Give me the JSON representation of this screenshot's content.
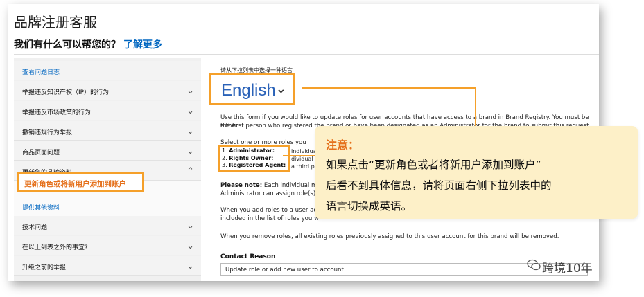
{
  "header": {
    "title": "品牌注册客服",
    "question": "我们有什么可以帮您的？",
    "learn_more": "了解更多"
  },
  "sidebar": {
    "items": [
      {
        "label": "查看问题日志",
        "chevron": ""
      },
      {
        "label": "举报违反知识产权（IP）的行为",
        "chevron": "⌄"
      },
      {
        "label": "举报违反市场政策的行为",
        "chevron": "⌄"
      },
      {
        "label": "撤销违规行为举报",
        "chevron": "⌄"
      },
      {
        "label": "商品页面问题",
        "chevron": "⌄"
      },
      {
        "label": "更新您的品牌资料",
        "chevron": "⌃"
      },
      {
        "label": "提供其他资料",
        "chevron": ""
      },
      {
        "label": "技术问题",
        "chevron": "⌄"
      },
      {
        "label": "在以上列表之外的事宜?",
        "chevron": "⌄"
      },
      {
        "label": "升级之前的举报",
        "chevron": "⌄"
      }
    ],
    "highlighted": "更新角色或将新用户添加到账户"
  },
  "main": {
    "select_prompt": "请从下拉列表中选择一种语言",
    "language": "English",
    "intro_line1": "Use this form if you would like to update roles for user accounts that have access to a brand in Brand Registry. You must be either",
    "intro_line2": "the first person who registered the brand or have been designated as an Administrator for the brand to submit this request.",
    "select_roles_fragment": "Select one or more roles you wou",
    "roles": [
      {
        "num": "1.",
        "name": "Administrator:",
        "side": "individual w"
      },
      {
        "num": "2.",
        "name": "Rights Owner:",
        "side": "dividual w"
      },
      {
        "num": "3.",
        "name": "Registered Agent:",
        "side": "a third part"
      }
    ],
    "note_bold": "Please note:",
    "note_fragment": " Each individual mus",
    "note_line2": "Administrator can assign role(s) f",
    "add_line1": "When you add roles to a user acc",
    "add_line2": "included in the list of roles you w",
    "remove_line": "When you remove roles, all existing roles previously assigned to this user account for this brand will be removed.",
    "contact_label": "Contact Reason",
    "contact_value": "Update role or add new user to account"
  },
  "note": {
    "title": "注意：",
    "lines": [
      "如果点击“更新角色或者将新用户添加到账户”",
      "后看不到具体信息，请将页面右侧下拉列表中的",
      "语言切换成英语。"
    ]
  },
  "watermark": "跨境10年",
  "colors": {
    "accent_orange": "#f5a02a",
    "note_bg": "#fdf0c8",
    "link_blue": "#0066c0",
    "note_title": "#e5711c"
  }
}
